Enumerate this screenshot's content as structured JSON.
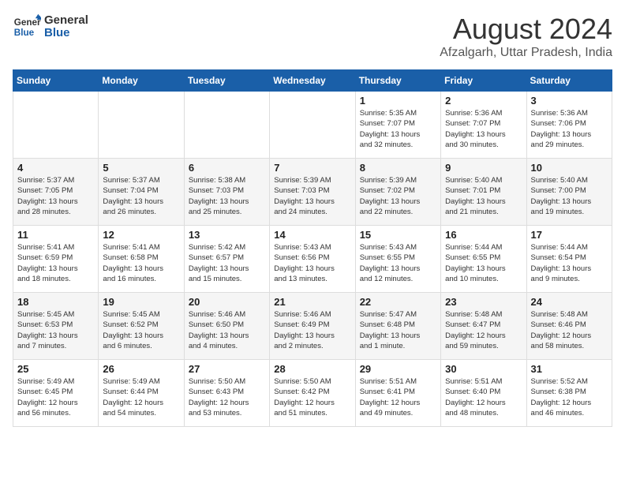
{
  "logo": {
    "line1": "General",
    "line2": "Blue"
  },
  "title": {
    "month_year": "August 2024",
    "location": "Afzalgarh, Uttar Pradesh, India"
  },
  "days_of_week": [
    "Sunday",
    "Monday",
    "Tuesday",
    "Wednesday",
    "Thursday",
    "Friday",
    "Saturday"
  ],
  "weeks": [
    [
      {
        "day": "",
        "info": ""
      },
      {
        "day": "",
        "info": ""
      },
      {
        "day": "",
        "info": ""
      },
      {
        "day": "",
        "info": ""
      },
      {
        "day": "1",
        "info": "Sunrise: 5:35 AM\nSunset: 7:07 PM\nDaylight: 13 hours\nand 32 minutes."
      },
      {
        "day": "2",
        "info": "Sunrise: 5:36 AM\nSunset: 7:07 PM\nDaylight: 13 hours\nand 30 minutes."
      },
      {
        "day": "3",
        "info": "Sunrise: 5:36 AM\nSunset: 7:06 PM\nDaylight: 13 hours\nand 29 minutes."
      }
    ],
    [
      {
        "day": "4",
        "info": "Sunrise: 5:37 AM\nSunset: 7:05 PM\nDaylight: 13 hours\nand 28 minutes."
      },
      {
        "day": "5",
        "info": "Sunrise: 5:37 AM\nSunset: 7:04 PM\nDaylight: 13 hours\nand 26 minutes."
      },
      {
        "day": "6",
        "info": "Sunrise: 5:38 AM\nSunset: 7:03 PM\nDaylight: 13 hours\nand 25 minutes."
      },
      {
        "day": "7",
        "info": "Sunrise: 5:39 AM\nSunset: 7:03 PM\nDaylight: 13 hours\nand 24 minutes."
      },
      {
        "day": "8",
        "info": "Sunrise: 5:39 AM\nSunset: 7:02 PM\nDaylight: 13 hours\nand 22 minutes."
      },
      {
        "day": "9",
        "info": "Sunrise: 5:40 AM\nSunset: 7:01 PM\nDaylight: 13 hours\nand 21 minutes."
      },
      {
        "day": "10",
        "info": "Sunrise: 5:40 AM\nSunset: 7:00 PM\nDaylight: 13 hours\nand 19 minutes."
      }
    ],
    [
      {
        "day": "11",
        "info": "Sunrise: 5:41 AM\nSunset: 6:59 PM\nDaylight: 13 hours\nand 18 minutes."
      },
      {
        "day": "12",
        "info": "Sunrise: 5:41 AM\nSunset: 6:58 PM\nDaylight: 13 hours\nand 16 minutes."
      },
      {
        "day": "13",
        "info": "Sunrise: 5:42 AM\nSunset: 6:57 PM\nDaylight: 13 hours\nand 15 minutes."
      },
      {
        "day": "14",
        "info": "Sunrise: 5:43 AM\nSunset: 6:56 PM\nDaylight: 13 hours\nand 13 minutes."
      },
      {
        "day": "15",
        "info": "Sunrise: 5:43 AM\nSunset: 6:55 PM\nDaylight: 13 hours\nand 12 minutes."
      },
      {
        "day": "16",
        "info": "Sunrise: 5:44 AM\nSunset: 6:55 PM\nDaylight: 13 hours\nand 10 minutes."
      },
      {
        "day": "17",
        "info": "Sunrise: 5:44 AM\nSunset: 6:54 PM\nDaylight: 13 hours\nand 9 minutes."
      }
    ],
    [
      {
        "day": "18",
        "info": "Sunrise: 5:45 AM\nSunset: 6:53 PM\nDaylight: 13 hours\nand 7 minutes."
      },
      {
        "day": "19",
        "info": "Sunrise: 5:45 AM\nSunset: 6:52 PM\nDaylight: 13 hours\nand 6 minutes."
      },
      {
        "day": "20",
        "info": "Sunrise: 5:46 AM\nSunset: 6:50 PM\nDaylight: 13 hours\nand 4 minutes."
      },
      {
        "day": "21",
        "info": "Sunrise: 5:46 AM\nSunset: 6:49 PM\nDaylight: 13 hours\nand 2 minutes."
      },
      {
        "day": "22",
        "info": "Sunrise: 5:47 AM\nSunset: 6:48 PM\nDaylight: 13 hours\nand 1 minute."
      },
      {
        "day": "23",
        "info": "Sunrise: 5:48 AM\nSunset: 6:47 PM\nDaylight: 12 hours\nand 59 minutes."
      },
      {
        "day": "24",
        "info": "Sunrise: 5:48 AM\nSunset: 6:46 PM\nDaylight: 12 hours\nand 58 minutes."
      }
    ],
    [
      {
        "day": "25",
        "info": "Sunrise: 5:49 AM\nSunset: 6:45 PM\nDaylight: 12 hours\nand 56 minutes."
      },
      {
        "day": "26",
        "info": "Sunrise: 5:49 AM\nSunset: 6:44 PM\nDaylight: 12 hours\nand 54 minutes."
      },
      {
        "day": "27",
        "info": "Sunrise: 5:50 AM\nSunset: 6:43 PM\nDaylight: 12 hours\nand 53 minutes."
      },
      {
        "day": "28",
        "info": "Sunrise: 5:50 AM\nSunset: 6:42 PM\nDaylight: 12 hours\nand 51 minutes."
      },
      {
        "day": "29",
        "info": "Sunrise: 5:51 AM\nSunset: 6:41 PM\nDaylight: 12 hours\nand 49 minutes."
      },
      {
        "day": "30",
        "info": "Sunrise: 5:51 AM\nSunset: 6:40 PM\nDaylight: 12 hours\nand 48 minutes."
      },
      {
        "day": "31",
        "info": "Sunrise: 5:52 AM\nSunset: 6:38 PM\nDaylight: 12 hours\nand 46 minutes."
      }
    ]
  ]
}
